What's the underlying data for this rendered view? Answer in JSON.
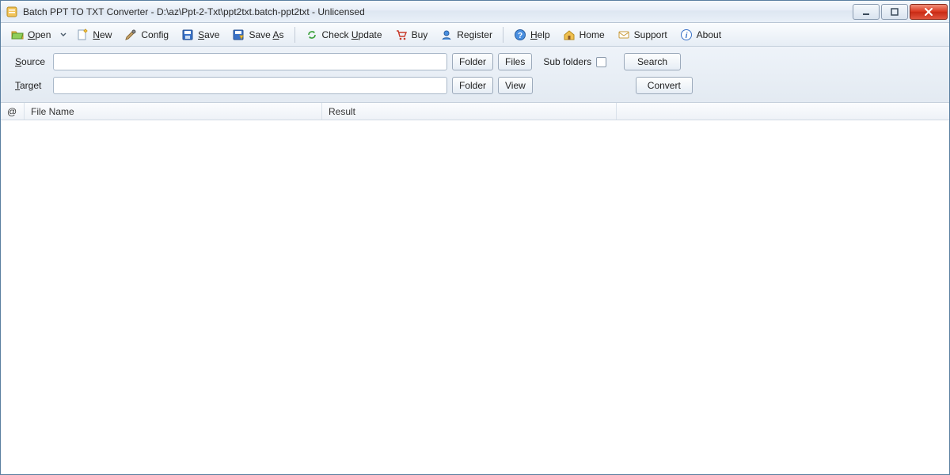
{
  "window": {
    "title": "Batch PPT TO TXT Converter - D:\\az\\Ppt-2-Txt\\ppt2txt.batch-ppt2txt - Unlicensed"
  },
  "toolbar": {
    "open": {
      "label": "Open",
      "u": 0
    },
    "new": {
      "label": "New",
      "u": 0
    },
    "config": {
      "label": "Config"
    },
    "save": {
      "label": "Save",
      "u": 0
    },
    "save_as": {
      "label": "Save As",
      "u": 5
    },
    "check_update": {
      "label": "Check Update",
      "u": 6
    },
    "buy": {
      "label": "Buy"
    },
    "register": {
      "label": "Register"
    },
    "help": {
      "label": "Help",
      "u": 0
    },
    "home": {
      "label": "Home"
    },
    "support": {
      "label": "Support"
    },
    "about": {
      "label": "About"
    }
  },
  "io": {
    "source_label": "Source",
    "source_u": 0,
    "source_value": "",
    "target_label": "Target",
    "target_u": 0,
    "target_value": "",
    "folder_btn": "Folder",
    "files_btn": "Files",
    "view_btn": "View",
    "subfolders_lbl": "Sub folders",
    "subfolders_checked": false,
    "search_btn": "Search",
    "convert_btn": "Convert"
  },
  "table": {
    "columns": {
      "at": "@",
      "file_name": "File Name",
      "result": "Result"
    },
    "rows": []
  }
}
